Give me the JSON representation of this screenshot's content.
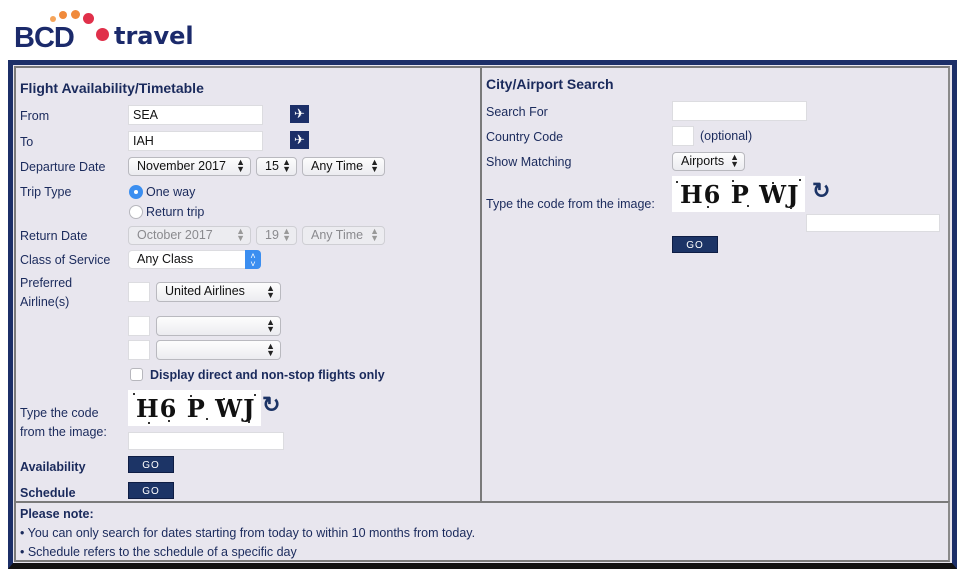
{
  "brand": {
    "name_left": "BCD",
    "name_right": "travel",
    "colors": {
      "navy": "#1b2a6b",
      "red": "#e0304a",
      "orange": "#f08a3c"
    }
  },
  "flight": {
    "title": "Flight Availability/Timetable",
    "from": {
      "label": "From",
      "value": "SEA",
      "icon": "airplane-icon"
    },
    "to": {
      "label": "To",
      "value": "IAH",
      "icon": "airplane-icon"
    },
    "departure": {
      "label": "Departure Date",
      "month": "November 2017",
      "day": "15",
      "time": "Any Time"
    },
    "trip_type": {
      "label": "Trip Type",
      "options": [
        {
          "label": "One way",
          "selected": true
        },
        {
          "label": "Return trip",
          "selected": false
        }
      ]
    },
    "return": {
      "label": "Return Date",
      "month": "October 2017",
      "day": "19",
      "time": "Any Time"
    },
    "class": {
      "label": "Class of Service",
      "value": "Any Class"
    },
    "airlines": {
      "label_line1": "Preferred",
      "label_line2": "Airline(s)",
      "rows": [
        {
          "code": "",
          "name": "United Airlines"
        },
        {
          "code": "",
          "name": ""
        },
        {
          "code": "",
          "name": ""
        }
      ]
    },
    "direct_only": {
      "label": "Display direct and non-stop flights only",
      "checked": false
    },
    "captcha": {
      "label_line1": "Type the code",
      "label_line2": "from the image:",
      "code": "H6 P WJ",
      "value": ""
    },
    "availability": {
      "label": "Availability",
      "button": "GO"
    },
    "schedule": {
      "label": "Schedule",
      "button": "GO"
    }
  },
  "city_search": {
    "title": "City/Airport Search",
    "search_for": {
      "label": "Search For",
      "value": ""
    },
    "country_code": {
      "label": "Country Code",
      "value": "",
      "hint": "(optional)"
    },
    "show_matching": {
      "label": "Show Matching",
      "value": "Airports"
    },
    "captcha": {
      "label": "Type the code from the image:",
      "code": "H6 P WJ",
      "value": ""
    },
    "button": "GO"
  },
  "notes": {
    "title": "Please note:",
    "items": [
      "• You can only search for dates starting from today to within 10 months from today.",
      "• Schedule refers to the schedule of a specific day"
    ]
  }
}
